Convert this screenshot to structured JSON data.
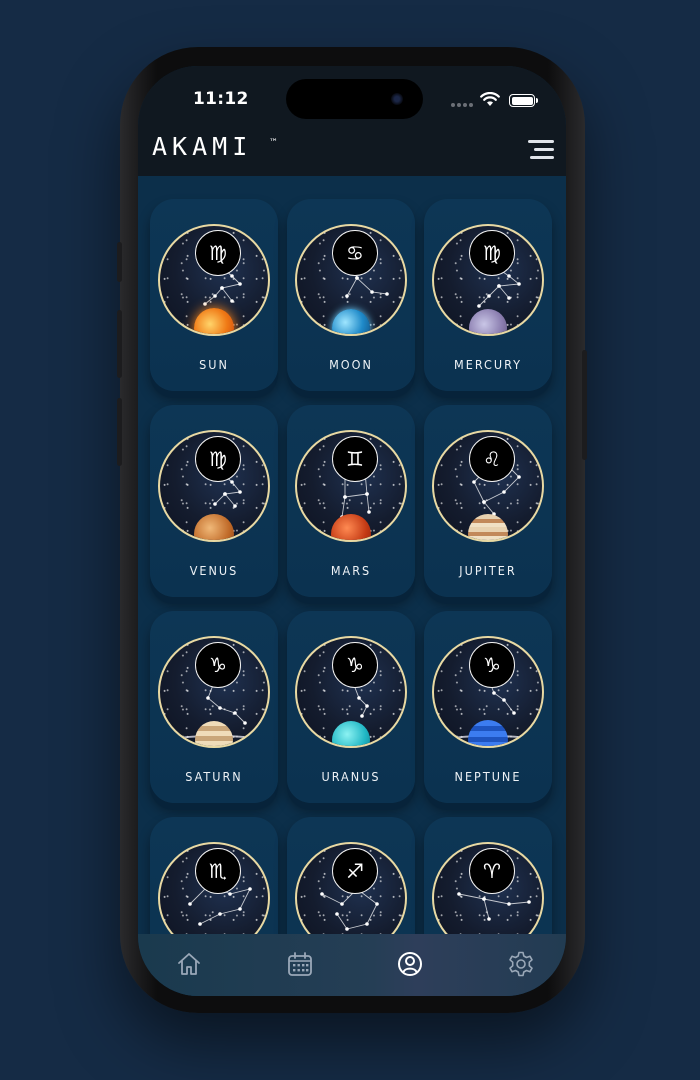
{
  "status_bar": {
    "time": "11:12"
  },
  "header": {
    "logo": "AKAMI",
    "trademark": "™"
  },
  "cards": [
    {
      "name": "SUN",
      "sign": "♍"
    },
    {
      "name": "MOON",
      "sign": "♋"
    },
    {
      "name": "MERCURY",
      "sign": "♍"
    },
    {
      "name": "VENUS",
      "sign": "♍"
    },
    {
      "name": "MARS",
      "sign": "♊"
    },
    {
      "name": "JUPITER",
      "sign": "♌"
    },
    {
      "name": "SATURN",
      "sign": "♑"
    },
    {
      "name": "URANUS",
      "sign": "♑"
    },
    {
      "name": "NEPTUNE",
      "sign": "♑"
    },
    {
      "name": "",
      "sign": "♏"
    },
    {
      "name": "",
      "sign": "♐"
    },
    {
      "name": "",
      "sign": "♈"
    }
  ],
  "tab_bar": {
    "items": [
      {
        "icon": "home-icon"
      },
      {
        "icon": "calendar-icon"
      },
      {
        "icon": "profile-icon",
        "active": true
      },
      {
        "icon": "settings-icon"
      }
    ]
  },
  "colors": {
    "background": "#152b45",
    "card": "#0d3655",
    "ring": "#e8d9a3"
  }
}
